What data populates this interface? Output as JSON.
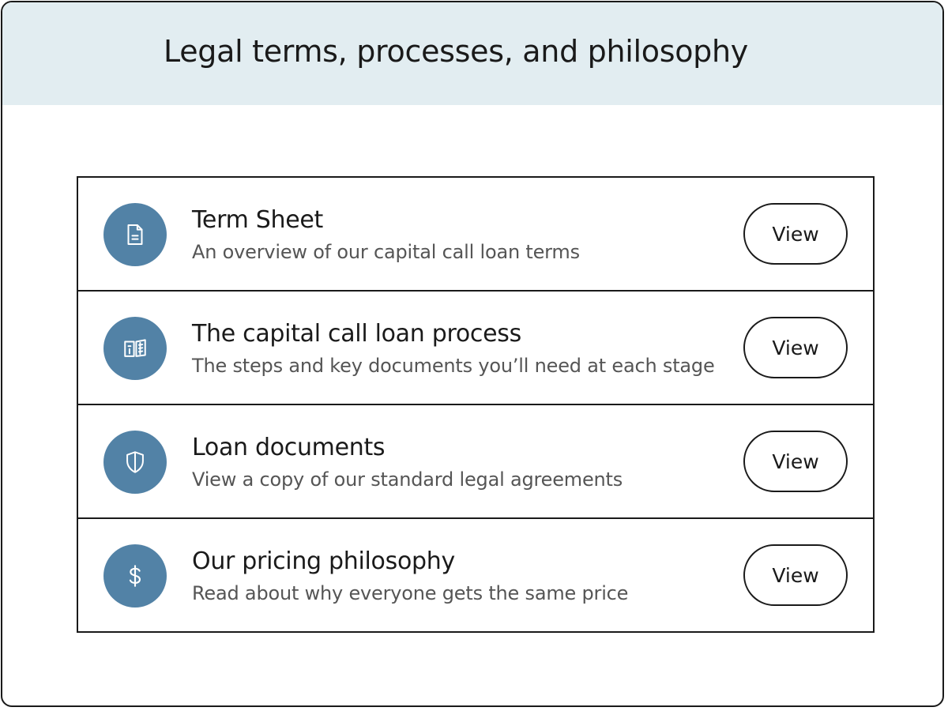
{
  "header": {
    "title": "Legal terms, processes, and philosophy"
  },
  "theme": {
    "header_bg": "#e2edf1",
    "icon_bg": "#5282a6",
    "border": "#1a1a1a"
  },
  "items": [
    {
      "icon": "document-icon",
      "title": "Term Sheet",
      "description": "An overview of our capital call loan terms",
      "button_label": "View"
    },
    {
      "icon": "open-book-icon",
      "title": "The capital call loan process",
      "description": "The steps and key documents you’ll need at each stage",
      "button_label": "View"
    },
    {
      "icon": "shield-icon",
      "title": "Loan documents",
      "description": "View a copy of our standard legal agreements",
      "button_label": "View"
    },
    {
      "icon": "dollar-icon",
      "title": "Our pricing philosophy",
      "description": "Read about why everyone gets the same price",
      "button_label": "View"
    }
  ]
}
